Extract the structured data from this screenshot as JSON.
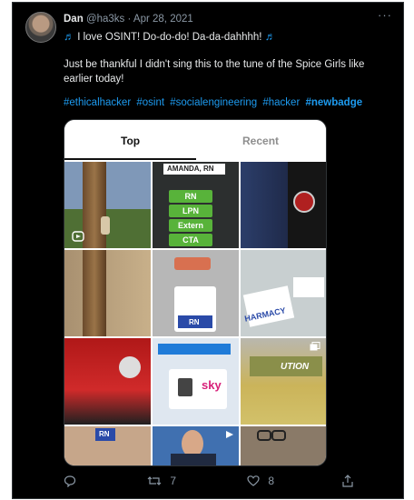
{
  "tweet": {
    "author_name": "Dan",
    "handle": "@ha3ks",
    "separator": "·",
    "date": "Apr 28, 2021",
    "more": "···",
    "text_line1": "I love OSINT! Do-do-do! Da-da-dahhhh!",
    "note_icon": "♬",
    "text_line2": "Just be thankful I didn't sing this to the tune of the Spice Girls like earlier today!",
    "hashtags": [
      "#ethicalhacker",
      "#osint",
      "#socialengineering",
      "#hacker",
      "#newbadge"
    ]
  },
  "media": {
    "tabs": [
      "Top",
      "Recent"
    ],
    "badge_name": "AMANDA, RN",
    "badge_pills": [
      "RN",
      "LPN",
      "Extern",
      "CTA"
    ],
    "badge_rn": "RN",
    "harmacy_text": "HARMACY",
    "sky_text": "sky",
    "rn_small": "RN",
    "lanyard_text": "UTION"
  },
  "actions": {
    "reply_count": "",
    "retweet_count": "7",
    "like_count": "8"
  },
  "colors": {
    "accent": "#1d9bf0",
    "background": "#000000",
    "muted": "#8b98a5"
  }
}
